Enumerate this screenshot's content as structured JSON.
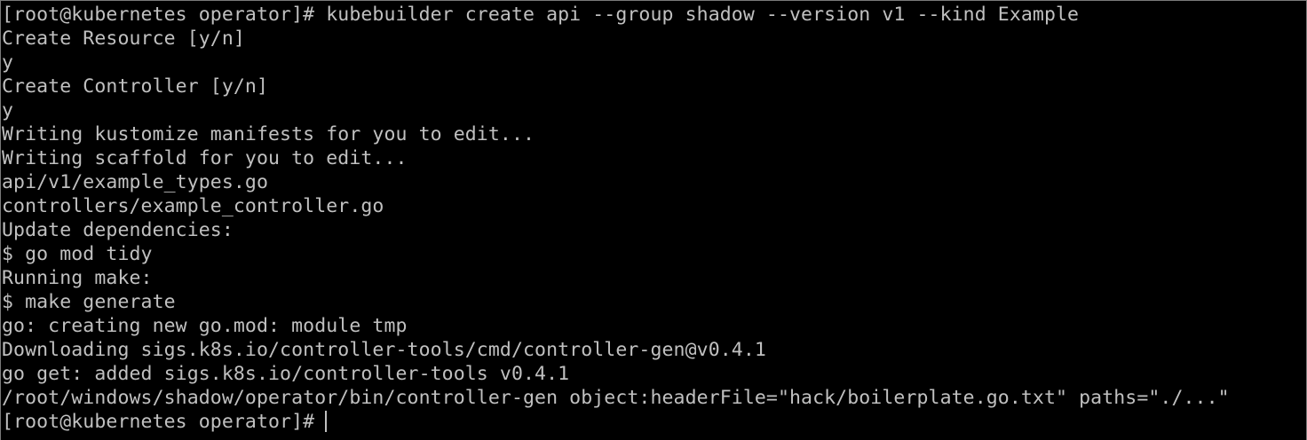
{
  "terminal": {
    "lines": [
      "[root@kubernetes operator]# kubebuilder create api --group shadow --version v1 --kind Example",
      "Create Resource [y/n]",
      "y",
      "Create Controller [y/n]",
      "y",
      "Writing kustomize manifests for you to edit...",
      "Writing scaffold for you to edit...",
      "api/v1/example_types.go",
      "controllers/example_controller.go",
      "Update dependencies:",
      "$ go mod tidy",
      "Running make:",
      "$ make generate",
      "go: creating new go.mod: module tmp",
      "Downloading sigs.k8s.io/controller-tools/cmd/controller-gen@v0.4.1",
      "go get: added sigs.k8s.io/controller-tools v0.4.1",
      "/root/windows/shadow/operator/bin/controller-gen object:headerFile=\"hack/boilerplate.go.txt\" paths=\"./...\""
    ],
    "prompt": "[root@kubernetes operator]#"
  }
}
